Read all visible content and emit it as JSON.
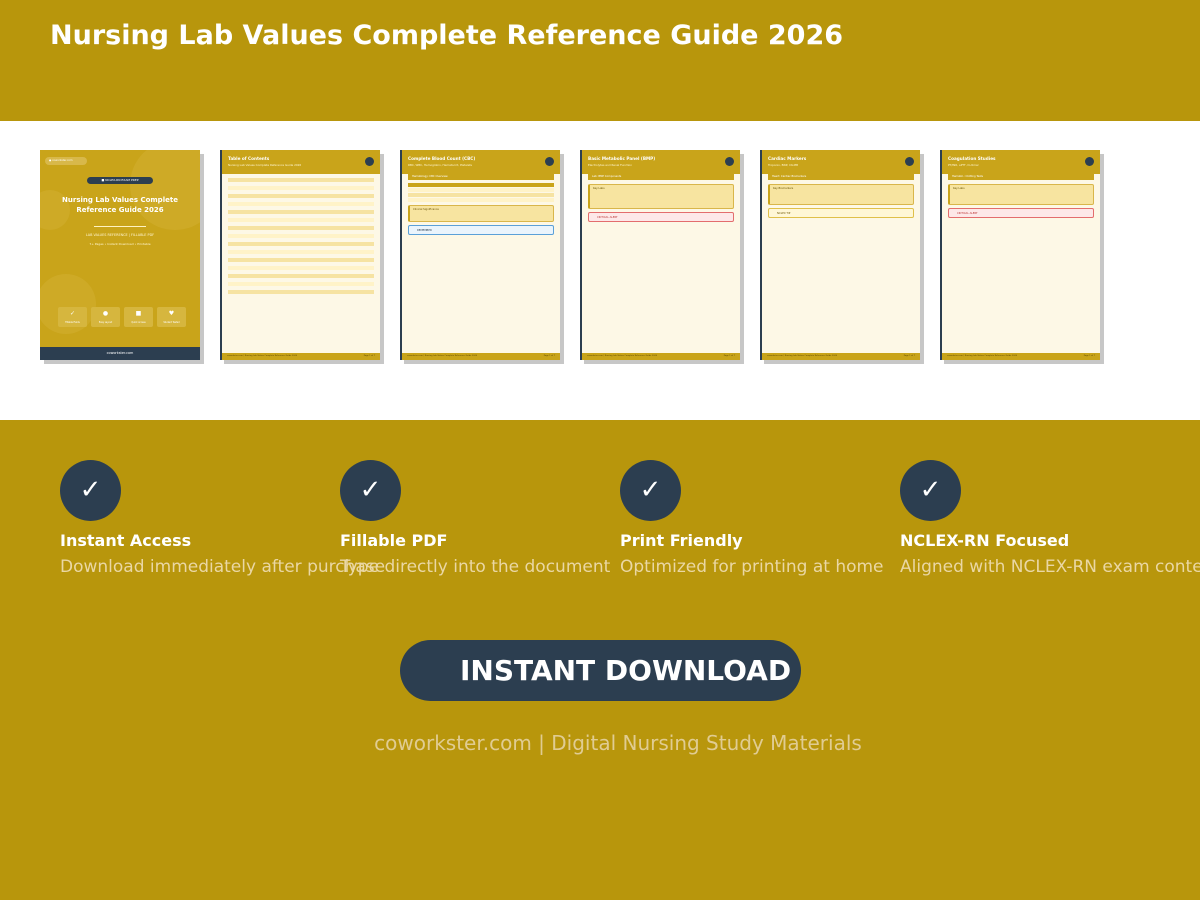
{
  "header": {
    "title": "Nursing Lab Values Complete Reference Guide 2026"
  },
  "colors": {
    "gold": "#b8960c",
    "navy": "#2c3e50",
    "page": "#fdf8e6",
    "white": "#ffffff"
  },
  "cover": {
    "pill": "● coworkster.com",
    "tag": "■ NCLEX-RN EXAM PREP",
    "title_line1": "Nursing Lab Values Complete",
    "title_line2": "Reference Guide 2026",
    "subtitle": "LAB VALUES REFERENCE | FILLABLE PDF",
    "details": "7+ Pages • Instant Download • Printable",
    "features": [
      {
        "icon": "✓",
        "label": "Fillable Fields"
      },
      {
        "icon": "●",
        "label": "Easy Layout"
      },
      {
        "icon": "■",
        "label": "Quick Access"
      },
      {
        "icon": "♥",
        "label": "Student Tested"
      }
    ],
    "footer": "coworkster.com"
  },
  "pages": [
    {
      "title": "Table of Contents",
      "subtitle": "Nursing Lab Values Complete Reference Guide 2026"
    },
    {
      "title": "Complete Blood Count (CBC)",
      "subtitle": "RBC, WBC, Hemoglobin, Hematocrit, Platelets",
      "section": "Hematology: CBC Overview",
      "box": "Clinical Significance",
      "info": "REMEMBER"
    },
    {
      "title": "Basic Metabolic Panel (BMP)",
      "subtitle": "Electrolytes and Renal Function",
      "section": "Lab: BMP Components",
      "box": "Key Labs",
      "alert": "CRITICAL ALERT"
    },
    {
      "title": "Cardiac Markers",
      "subtitle": "Troponin, BNP, CK-MB",
      "section": "Heart: Cardiac Biomarkers",
      "box": "Key Biomarkers",
      "warn": "NCLEX TIP"
    },
    {
      "title": "Coagulation Studies",
      "subtitle": "PT/INR, aPTT, D-dimer",
      "section": "Hematol.: Clotting Tests",
      "box": "Key Labs",
      "alert": "CRITICAL ALERT"
    }
  ],
  "page_footer_left": "coworkster.com | Nursing Lab Values Complete Reference Guide 2026",
  "page_footer_right": "Page 1 of 7",
  "features": [
    {
      "icon": "✓",
      "title": "Instant Access",
      "desc": "Download immediately after purchase"
    },
    {
      "icon": "✓",
      "title": "Fillable PDF",
      "desc": "Type directly into the document"
    },
    {
      "icon": "✓",
      "title": "Print Friendly",
      "desc": "Optimized for printing at home"
    },
    {
      "icon": "✓",
      "title": "NCLEX-RN Focused",
      "desc": "Aligned with NCLEX-RN exam content"
    }
  ],
  "cta": {
    "label": "INSTANT DOWNLOAD"
  },
  "footer": {
    "text": "coworkster.com | Digital Nursing Study Materials"
  }
}
